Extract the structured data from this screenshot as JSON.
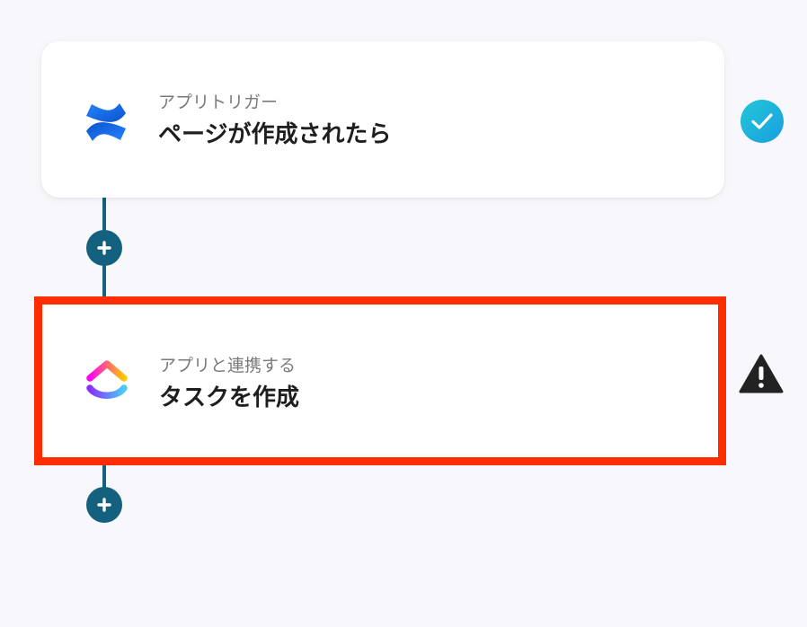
{
  "flow": {
    "steps": [
      {
        "type": "trigger",
        "app_icon": "confluence-logo-icon",
        "subtitle": "アプリトリガー",
        "title": "ページが作成されたら",
        "status_icon": "check-circle-icon",
        "status": "completed"
      },
      {
        "type": "action",
        "app_icon": "clickup-logo-icon",
        "subtitle": "アプリと連携する",
        "title": "タスクを作成",
        "status_icon": "warning-triangle-icon",
        "status": "incomplete",
        "highlighted": true
      }
    ],
    "add_step_icon": "plus-icon"
  },
  "colors": {
    "connector": "#13617e",
    "highlight_border": "#ff2d00",
    "check_gradient_start": "#22c6d8",
    "check_gradient_end": "#1a9fe0",
    "warning": "#222222"
  }
}
